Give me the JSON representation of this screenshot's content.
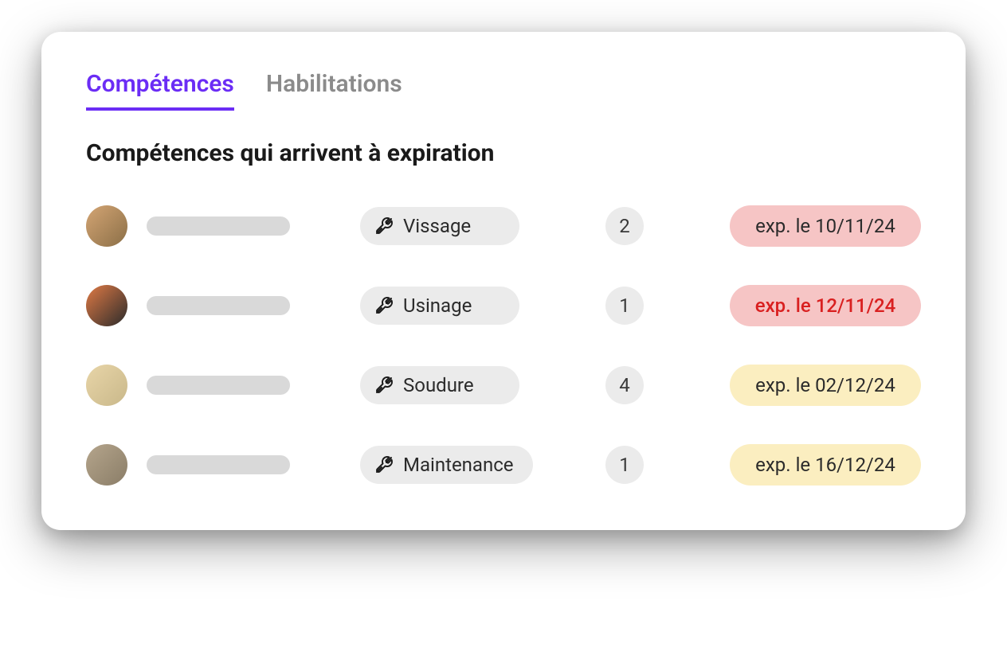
{
  "tabs": {
    "competences": "Compétences",
    "habilitations": "Habilitations"
  },
  "section_title": "Compétences qui arrivent à expiration",
  "rows": [
    {
      "skill": "Vissage",
      "count": "2",
      "exp": "exp. le 10/11/24",
      "style": "red"
    },
    {
      "skill": "Usinage",
      "count": "1",
      "exp": "exp. le 12/11/24",
      "style": "red-strong"
    },
    {
      "skill": "Soudure",
      "count": "4",
      "exp": "exp. le 02/12/24",
      "style": "yellow"
    },
    {
      "skill": "Maintenance",
      "count": "1",
      "exp": "exp. le 16/12/24",
      "style": "yellow"
    }
  ]
}
